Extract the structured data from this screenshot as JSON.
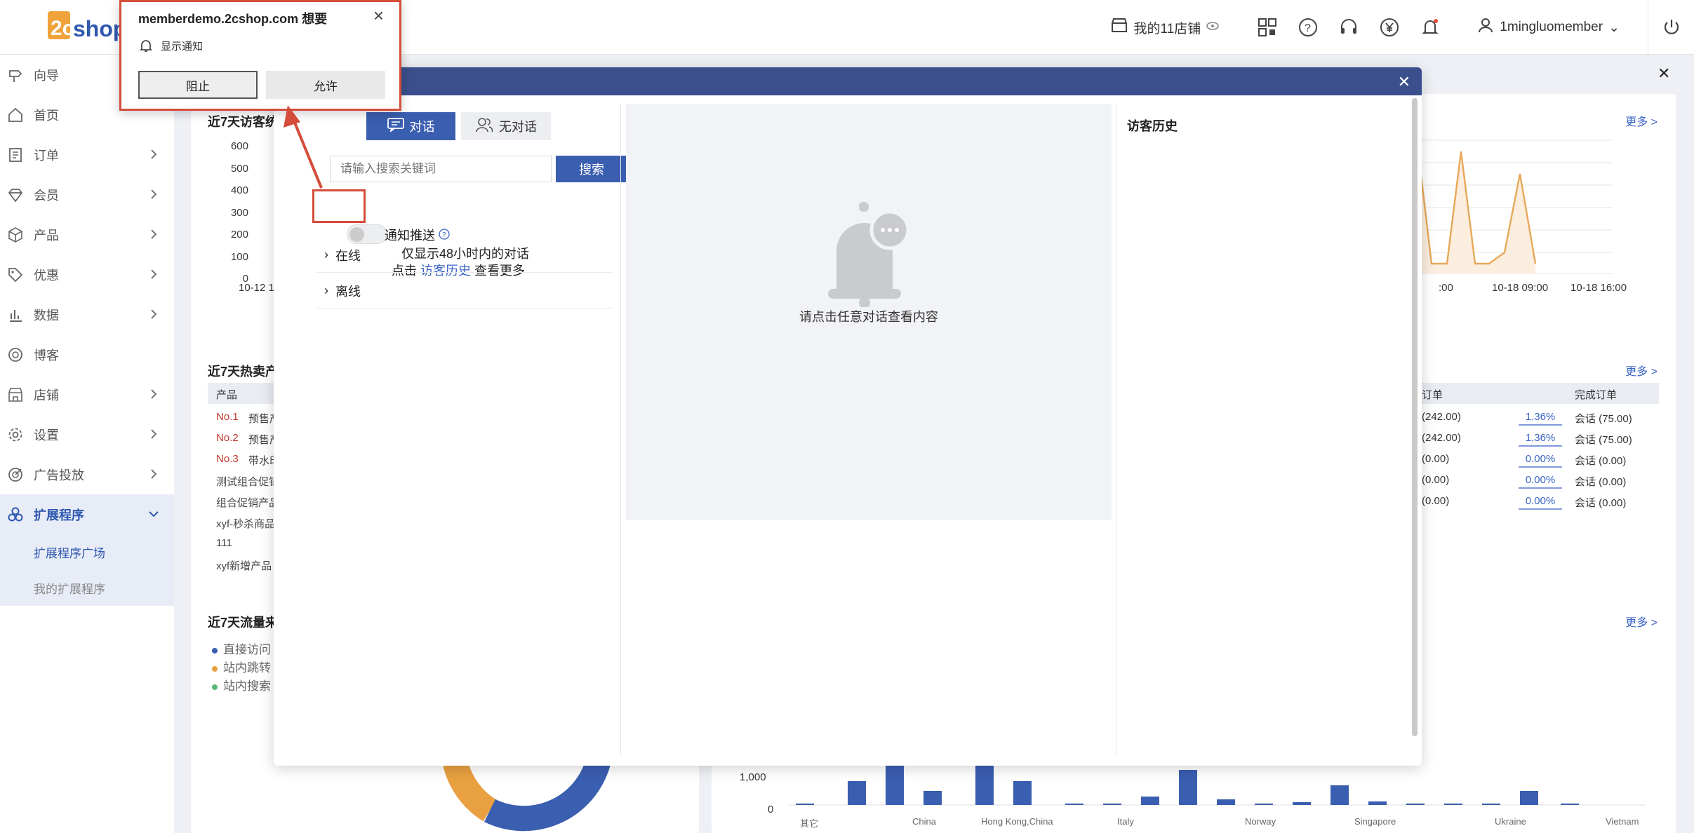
{
  "topbar": {
    "logo_text": "2cshop",
    "store_label": "我的11店铺",
    "username": "1mingluomember"
  },
  "sidebar": {
    "items": [
      {
        "label": "向导",
        "icon": "signpost-icon",
        "has_children": false
      },
      {
        "label": "首页",
        "icon": "home-icon",
        "has_children": false
      },
      {
        "label": "订单",
        "icon": "order-icon",
        "has_children": true
      },
      {
        "label": "会员",
        "icon": "diamond-icon",
        "has_children": true
      },
      {
        "label": "产品",
        "icon": "box-icon",
        "has_children": true
      },
      {
        "label": "优惠",
        "icon": "tag-icon",
        "has_children": true
      },
      {
        "label": "数据",
        "icon": "bar-chart-icon",
        "has_children": true
      },
      {
        "label": "博客",
        "icon": "blog-icon",
        "has_children": false
      },
      {
        "label": "店铺",
        "icon": "store-icon",
        "has_children": true
      },
      {
        "label": "设置",
        "icon": "gear-icon",
        "has_children": true
      },
      {
        "label": "广告投放",
        "icon": "target-icon",
        "has_children": true
      },
      {
        "label": "扩展程序",
        "icon": "apps-icon",
        "has_children": true
      }
    ],
    "sub_items": [
      "扩展程序广场",
      "我的扩展程序"
    ]
  },
  "dashboard": {
    "visitors_title": "近7天访客统",
    "visitors_yticks": [
      "600",
      "500",
      "400",
      "300",
      "200",
      "100",
      "0"
    ],
    "visitors_xtick": "10-12 1",
    "right_chart_xticks": [
      ":00",
      "10-18 09:00",
      "10-18 16:00"
    ],
    "more": "更多 >",
    "hot_title": "近7天热卖产",
    "hot_header_product": "产品",
    "hot_header_order": "订单",
    "hot_header_done": "完成订单",
    "hot_rows": [
      {
        "rank": "No.1",
        "name": "预售产",
        "amount": "(242.00)",
        "rate": "1.36%",
        "done": "会话  (75.00)"
      },
      {
        "rank": "No.2",
        "name": "预售产",
        "amount": "(242.00)",
        "rate": "1.36%",
        "done": "会话  (75.00)"
      },
      {
        "rank": "No.3",
        "name": "带水印",
        "amount": "(0.00)",
        "rate": "0.00%",
        "done": "会话  (0.00)"
      },
      {
        "rank": "",
        "name": "测试组合促销",
        "amount": "(0.00)",
        "rate": "0.00%",
        "done": "会话  (0.00)"
      },
      {
        "rank": "",
        "name": "组合促销产品",
        "amount": "(0.00)",
        "rate": "0.00%",
        "done": "会话  (0.00)"
      },
      {
        "rank": "",
        "name": "xyf-秒杀商品",
        "amount": "",
        "rate": "",
        "done": ""
      },
      {
        "rank": "",
        "name": "111",
        "amount": "",
        "rate": "",
        "done": ""
      },
      {
        "rank": "",
        "name": "xyf新增产品",
        "amount": "",
        "rate": "",
        "done": ""
      }
    ],
    "traffic_title": "近7天流量来",
    "traffic_legend": [
      "直接访问",
      "站内跳转",
      "站内搜索"
    ],
    "country_yticks": [
      "1,000",
      "0"
    ],
    "country_xticks": [
      "其它",
      "China",
      "Hong Kong,China",
      "Italy",
      "Norway",
      "Singapore",
      "Ukraine",
      "Vietnam"
    ]
  },
  "chat": {
    "tab_dialog": "对话",
    "tab_no_dialog": "无对话",
    "search_placeholder": "请输入搜索关键词",
    "search_button": "搜索",
    "notify_label": "通知推送",
    "hint_line1": "仅显示48小时内的对话",
    "hint_click": "点击",
    "hint_link": "访客历史",
    "hint_more": "查看更多",
    "group_online": "在线",
    "group_offline": "离线",
    "empty_text": "请点击任意对话查看内容",
    "history_title": "访客历史"
  },
  "permission": {
    "title": "memberdemo.2cshop.com 想要",
    "subtitle": "显示通知",
    "block": "阻止",
    "allow": "允许"
  },
  "colors": {
    "accent": "#3a5eb0",
    "header": "#3a4f8c",
    "highlight": "#d44c3a",
    "orange": "#e8a85a"
  }
}
